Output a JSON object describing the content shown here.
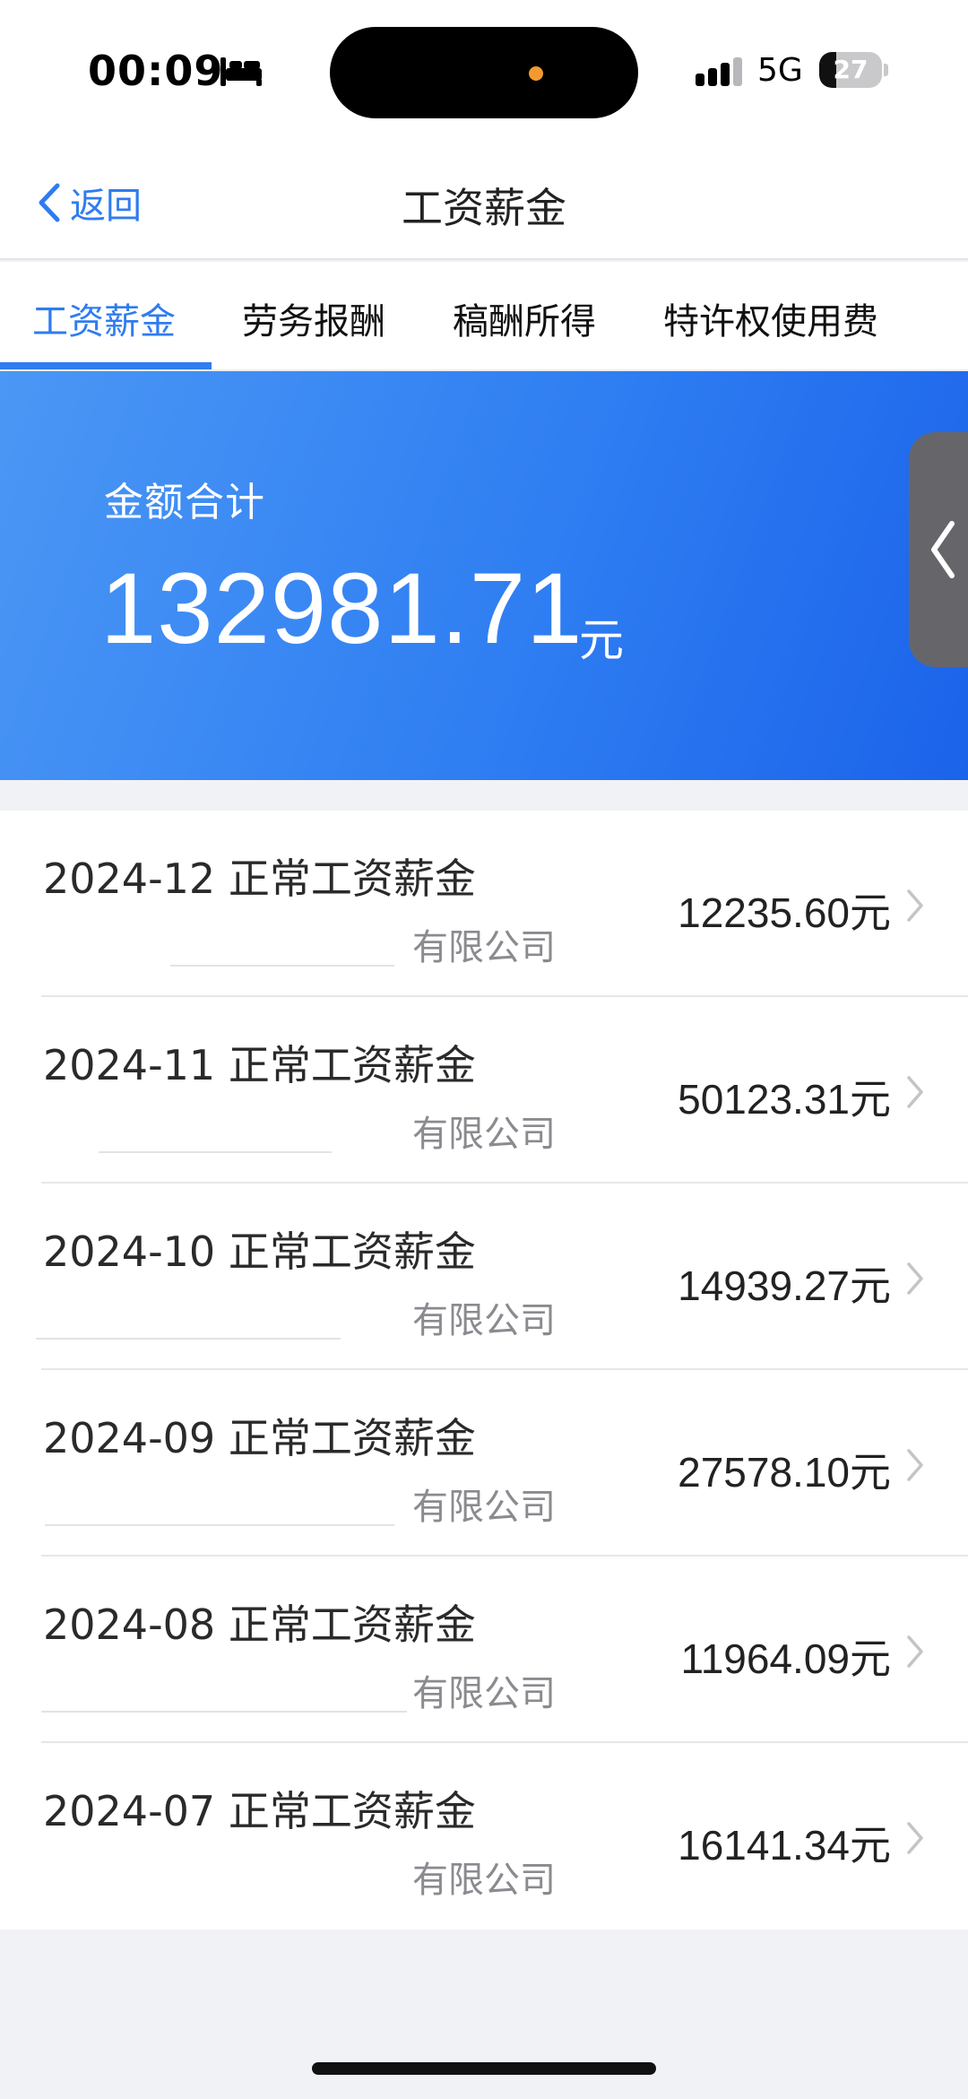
{
  "status": {
    "time": "00:09",
    "network": "5G",
    "battery": "27",
    "battery_level": 0.27
  },
  "nav": {
    "back_label": "返回",
    "title": "工资薪金"
  },
  "tabs": [
    {
      "label": "工资薪金",
      "active": true
    },
    {
      "label": "劳务报酬",
      "active": false
    },
    {
      "label": "稿酬所得",
      "active": false
    },
    {
      "label": "特许权使用费",
      "active": false
    }
  ],
  "summary": {
    "label": "金额合计",
    "amount": "132981.71",
    "unit": "元"
  },
  "records": [
    {
      "title": "2024-12 正常工资薪金",
      "company": "有限公司",
      "amount": "12235.60",
      "unit": "元"
    },
    {
      "title": "2024-11 正常工资薪金",
      "company": "有限公司",
      "amount": "50123.31",
      "unit": "元"
    },
    {
      "title": "2024-10 正常工资薪金",
      "company": "有限公司",
      "amount": "14939.27",
      "unit": "元"
    },
    {
      "title": "2024-09 正常工资薪金",
      "company": "有限公司",
      "amount": "27578.10",
      "unit": "元"
    },
    {
      "title": "2024-08 正常工资薪金",
      "company": "有限公司",
      "amount": "11964.09",
      "unit": "元"
    },
    {
      "title": "2024-07 正常工资薪金",
      "company": "有限公司",
      "amount": "16141.34",
      "unit": "元"
    }
  ],
  "colors": {
    "accent": "#2f7cf0",
    "banner_start": "#4b97f5",
    "banner_end": "#1b63ea"
  }
}
